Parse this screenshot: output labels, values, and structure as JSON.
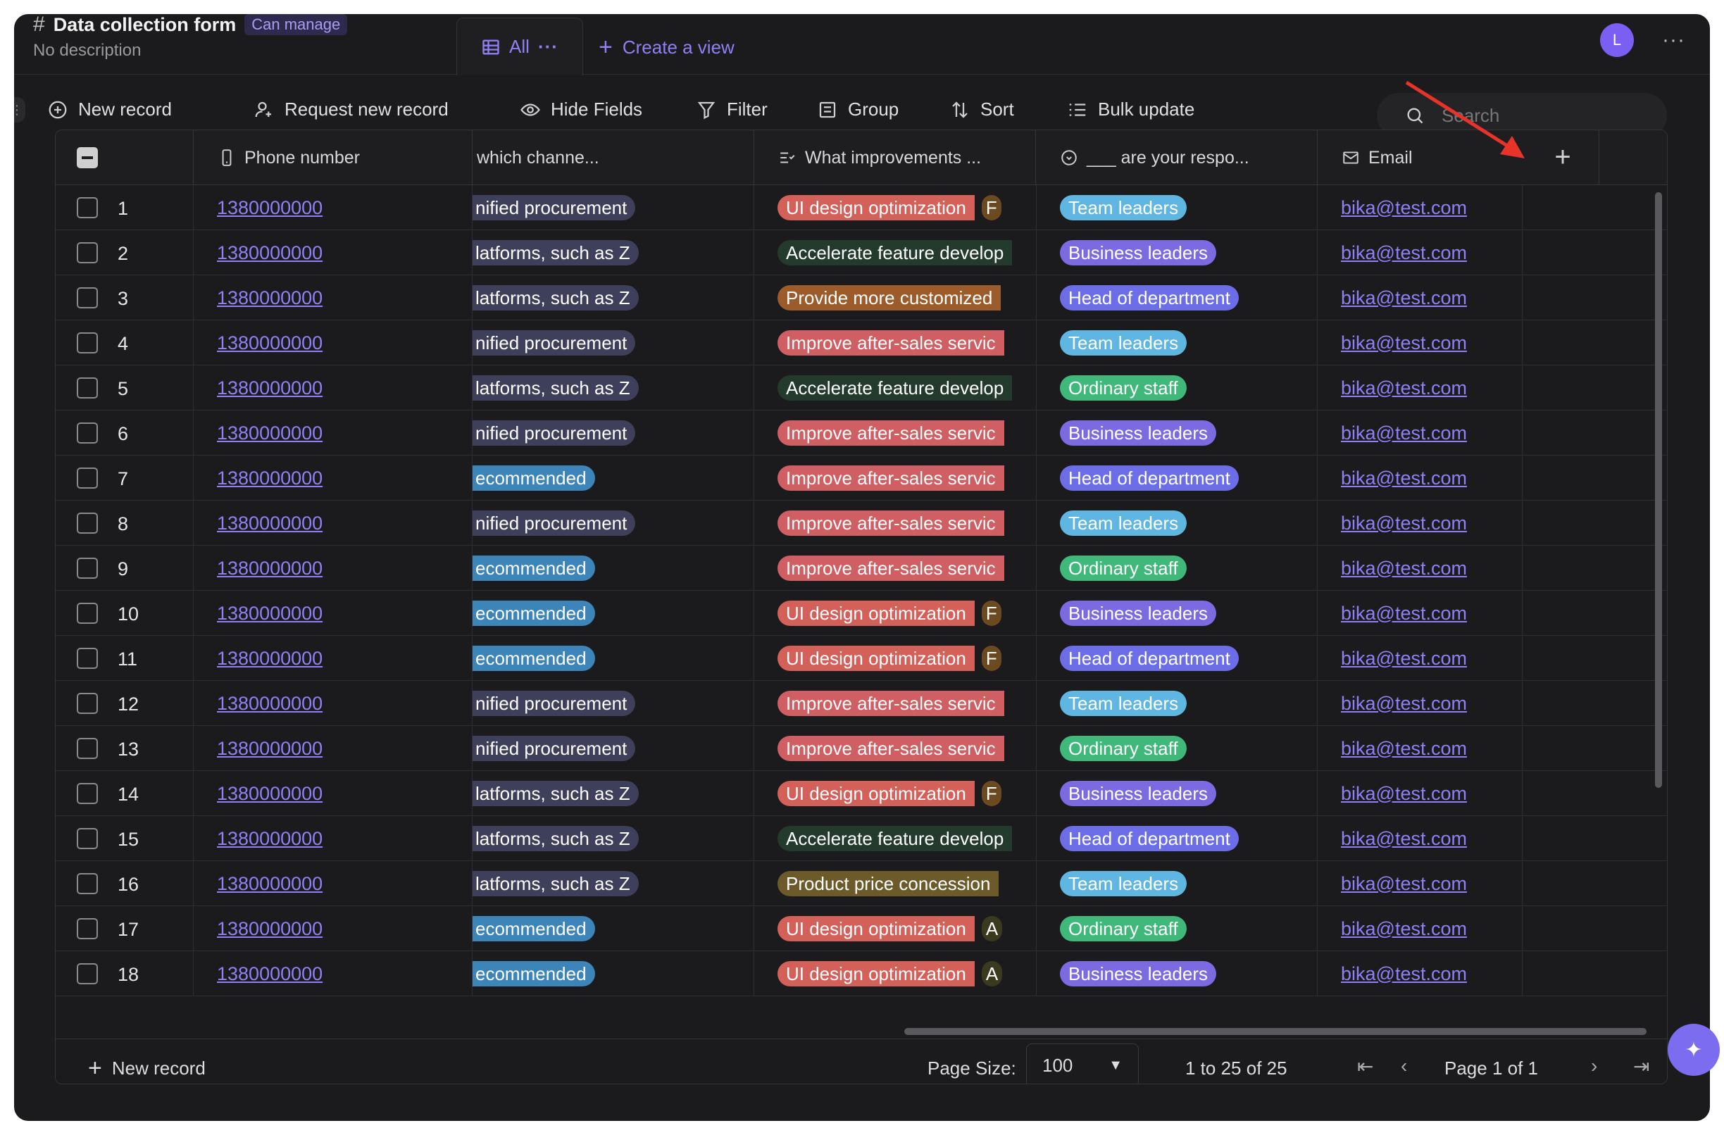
{
  "header": {
    "title": "Data collection form",
    "badge": "Can manage",
    "description": "No description",
    "view_tab": "All",
    "create_view": "Create a view",
    "avatar_letter": "L"
  },
  "toolbar": {
    "new_record": "New record",
    "request_record": "Request new record",
    "hide_fields": "Hide Fields",
    "filter": "Filter",
    "group": "Group",
    "sort": "Sort",
    "bulk_update": "Bulk update",
    "search_placeholder": "Search"
  },
  "columns": [
    "Phone number",
    "which channe...",
    "What improvements ...",
    "___ are your respo...",
    "Email"
  ],
  "colors": {
    "accent": "#8f80f5",
    "channel_pill": "#3e3f5a",
    "recommended_pill": "#3d84b8",
    "ui_design": "#d4605a",
    "after_sales": "#cf5f63",
    "accelerate": "#233a2d",
    "customized": "#9c5b2a",
    "price": "#6d5a2a",
    "team_leaders": "#5fb6e0",
    "business_leaders": "#7b6ae0",
    "head_of_department": "#6b6ee6",
    "ordinary_staff": "#3fb87a"
  },
  "rows": [
    {
      "n": "1",
      "phone": "1380000000",
      "channel": "nified procurement",
      "improve": "UI design optimization",
      "extra": "F",
      "role": "Team leaders",
      "email": "bika@test.com"
    },
    {
      "n": "2",
      "phone": "1380000000",
      "channel": "latforms, such as Z",
      "improve": "Accelerate feature develop",
      "extra": "",
      "role": "Business leaders",
      "email": "bika@test.com"
    },
    {
      "n": "3",
      "phone": "1380000000",
      "channel": "latforms, such as Z",
      "improve": "Provide more customized",
      "extra": "",
      "role": "Head of department",
      "email": "bika@test.com"
    },
    {
      "n": "4",
      "phone": "1380000000",
      "channel": "nified procurement",
      "improve": "Improve after-sales servic",
      "extra": "",
      "role": "Team leaders",
      "email": "bika@test.com"
    },
    {
      "n": "5",
      "phone": "1380000000",
      "channel": "latforms, such as Z",
      "improve": "Accelerate feature develop",
      "extra": "",
      "role": "Ordinary staff",
      "email": "bika@test.com"
    },
    {
      "n": "6",
      "phone": "1380000000",
      "channel": "nified procurement",
      "improve": "Improve after-sales servic",
      "extra": "",
      "role": "Business leaders",
      "email": "bika@test.com"
    },
    {
      "n": "7",
      "phone": "1380000000",
      "channel": "ecommended",
      "improve": "Improve after-sales servic",
      "extra": "",
      "role": "Head of department",
      "email": "bika@test.com"
    },
    {
      "n": "8",
      "phone": "1380000000",
      "channel": "nified procurement",
      "improve": "Improve after-sales servic",
      "extra": "",
      "role": "Team leaders",
      "email": "bika@test.com"
    },
    {
      "n": "9",
      "phone": "1380000000",
      "channel": "ecommended",
      "improve": "Improve after-sales servic",
      "extra": "",
      "role": "Ordinary staff",
      "email": "bika@test.com"
    },
    {
      "n": "10",
      "phone": "1380000000",
      "channel": "ecommended",
      "improve": "UI design optimization",
      "extra": "F",
      "role": "Business leaders",
      "email": "bika@test.com"
    },
    {
      "n": "11",
      "phone": "1380000000",
      "channel": "ecommended",
      "improve": "UI design optimization",
      "extra": "F",
      "role": "Head of department",
      "email": "bika@test.com"
    },
    {
      "n": "12",
      "phone": "1380000000",
      "channel": "nified procurement",
      "improve": "Improve after-sales servic",
      "extra": "",
      "role": "Team leaders",
      "email": "bika@test.com"
    },
    {
      "n": "13",
      "phone": "1380000000",
      "channel": "nified procurement",
      "improve": "Improve after-sales servic",
      "extra": "",
      "role": "Ordinary staff",
      "email": "bika@test.com"
    },
    {
      "n": "14",
      "phone": "1380000000",
      "channel": "latforms, such as Z",
      "improve": "UI design optimization",
      "extra": "F",
      "role": "Business leaders",
      "email": "bika@test.com"
    },
    {
      "n": "15",
      "phone": "1380000000",
      "channel": "latforms, such as Z",
      "improve": "Accelerate feature develop",
      "extra": "",
      "role": "Head of department",
      "email": "bika@test.com"
    },
    {
      "n": "16",
      "phone": "1380000000",
      "channel": "latforms, such as Z",
      "improve": "Product price concession",
      "extra": "",
      "role": "Team leaders",
      "email": "bika@test.com"
    },
    {
      "n": "17",
      "phone": "1380000000",
      "channel": "ecommended",
      "improve": "UI design optimization",
      "extra": "A",
      "role": "Ordinary staff",
      "email": "bika@test.com"
    },
    {
      "n": "18",
      "phone": "1380000000",
      "channel": "ecommended",
      "improve": "UI design optimization",
      "extra": "A",
      "role": "Business leaders",
      "email": "bika@test.com"
    }
  ],
  "footer": {
    "new_record": "New record",
    "page_size_label": "Page Size:",
    "page_size": "100",
    "range": "1 to 25 of 25",
    "page": "Page 1 of 1"
  }
}
